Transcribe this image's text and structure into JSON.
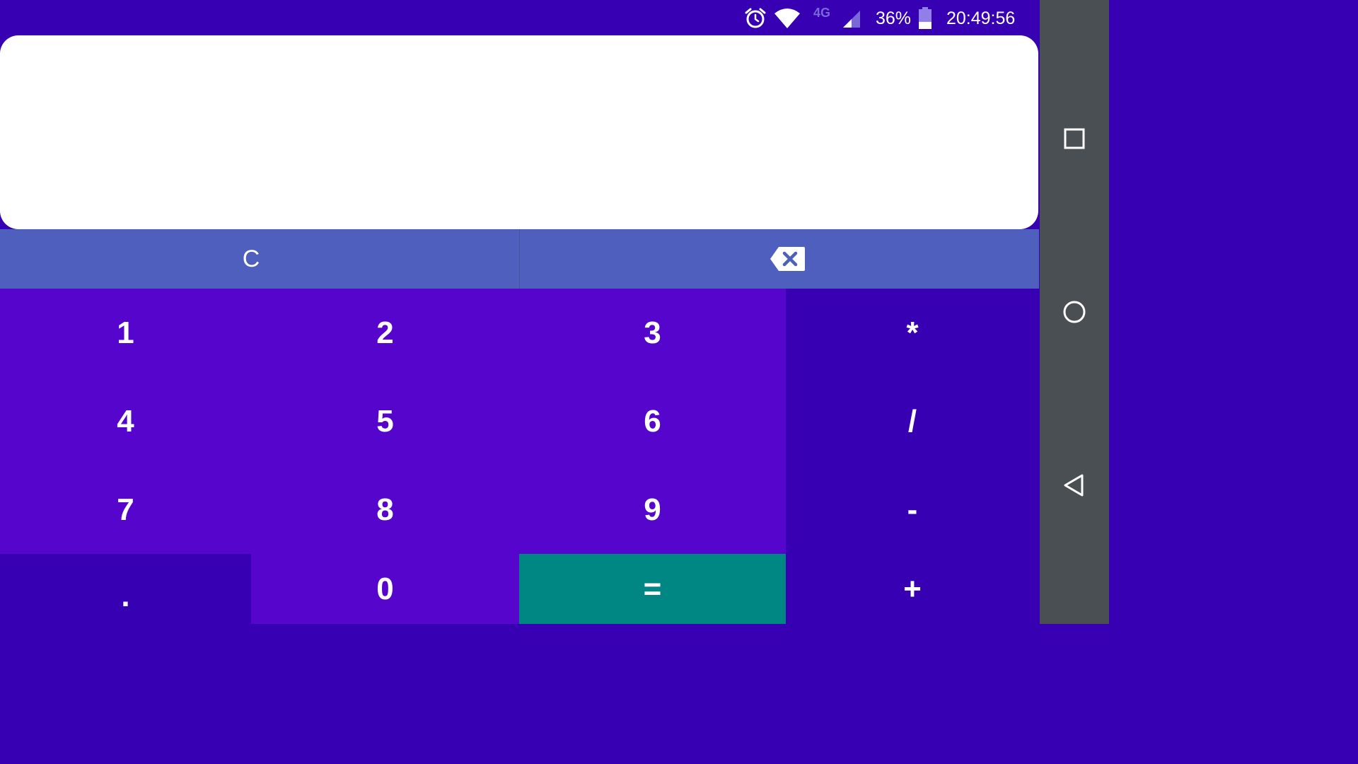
{
  "status_bar": {
    "network": "4G",
    "battery_percent": "36%",
    "battery_level": 0.36,
    "time": "20:49:56"
  },
  "display": {
    "expression": ""
  },
  "function_row": {
    "clear_label": "C"
  },
  "keys": {
    "one": "1",
    "two": "2",
    "three": "3",
    "multiply": "*",
    "four": "4",
    "five": "5",
    "six": "6",
    "divide": "/",
    "seven": "7",
    "eight": "8",
    "nine": "9",
    "minus": "-",
    "dot": ".",
    "zero": "0",
    "equals": "=",
    "plus": "+"
  },
  "colors": {
    "status_bar": "#3700b3",
    "number_key": "#5606cc",
    "operator_key": "#3700b3",
    "equals_key": "#008784",
    "function_row": "#4f5fbd",
    "nav_bar": "#4a4f54"
  },
  "icons": {
    "alarm": "alarm-icon",
    "wifi": "wifi-icon",
    "signal": "signal-icon",
    "battery": "battery-icon",
    "backspace": "backspace-icon",
    "recents": "square-icon",
    "home": "circle-icon",
    "back": "triangle-back-icon"
  }
}
